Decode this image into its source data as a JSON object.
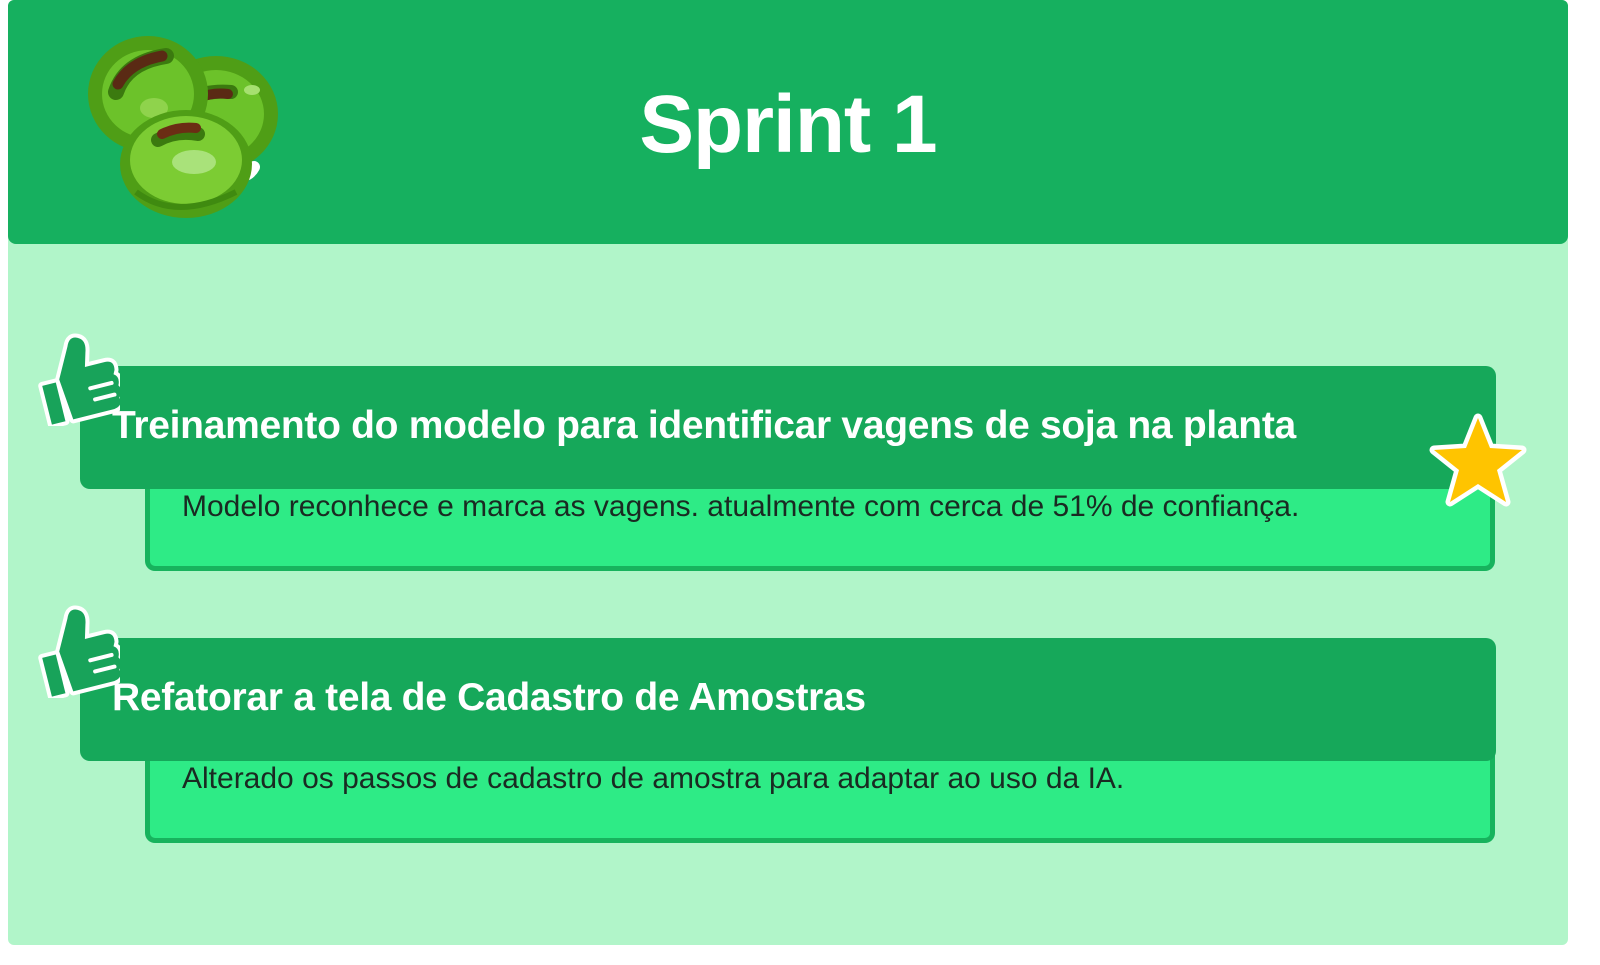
{
  "header": {
    "title": "Sprint 1",
    "logo_icon": "soybean-pods-icon"
  },
  "colors": {
    "header_bg": "#16b05f",
    "board_bg": "#b1f5c9",
    "card_head_bg": "#16a85a",
    "card_body_bg": "#2eeb86",
    "star": "#ffc400"
  },
  "cards": [
    {
      "title": "Treinamento do modelo para identificar vagens de soja na planta",
      "description": "Modelo reconhece e marca as vagens. atualmente com cerca de 51% de confiança.",
      "icon": "thumbs-up-icon",
      "badge_icon": "star-icon"
    },
    {
      "title": "Refatorar a tela de Cadastro de Amostras",
      "description": "Alterado os passos de cadastro de amostra para adaptar ao uso da IA.",
      "icon": "thumbs-up-icon"
    }
  ]
}
